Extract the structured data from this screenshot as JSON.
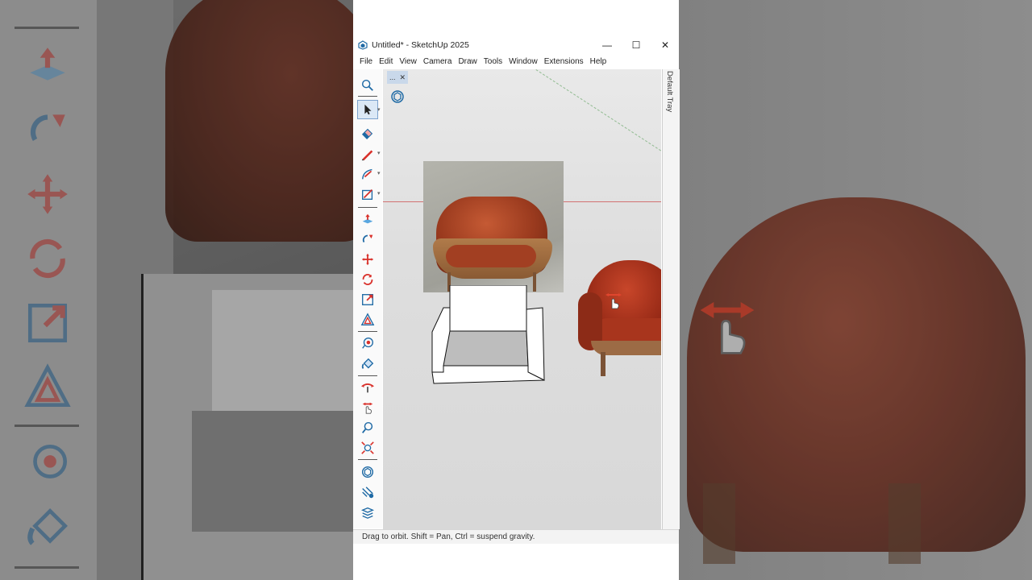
{
  "window": {
    "title": "Untitled* - SketchUp 2025",
    "controls": {
      "minimize": "—",
      "maximize": "☐",
      "close": "✕"
    }
  },
  "menu": [
    "File",
    "Edit",
    "View",
    "Camera",
    "Draw",
    "Tools",
    "Window",
    "Extensions",
    "Help"
  ],
  "toolbar": {
    "tools": [
      "zoom-icon",
      "select-icon",
      "eraser-icon",
      "pencil-line-icon",
      "arc-icon",
      "rectangle-icon",
      "push-pull-icon",
      "follow-me-icon",
      "move-icon",
      "rotate-icon",
      "scale-icon",
      "offset-icon",
      "tape-measure-icon",
      "paint-bucket-icon",
      "orbit-icon",
      "pan-icon",
      "zoom-window-icon",
      "zoom-extents-icon",
      "warehouse-icon",
      "extension-icon",
      "layers-icon"
    ],
    "active_tool": "select-icon"
  },
  "mini_panel": {
    "tab_label": "...",
    "tab_close": "✕"
  },
  "tray": {
    "label": "Default Tray"
  },
  "status": {
    "text": "Drag to orbit. Shift = Pan, Ctrl = suspend gravity."
  },
  "colors": {
    "accent_red": "#d9302a",
    "icon_blue": "#1f6aa5",
    "active_tool_bg": "#dbe8f6"
  }
}
